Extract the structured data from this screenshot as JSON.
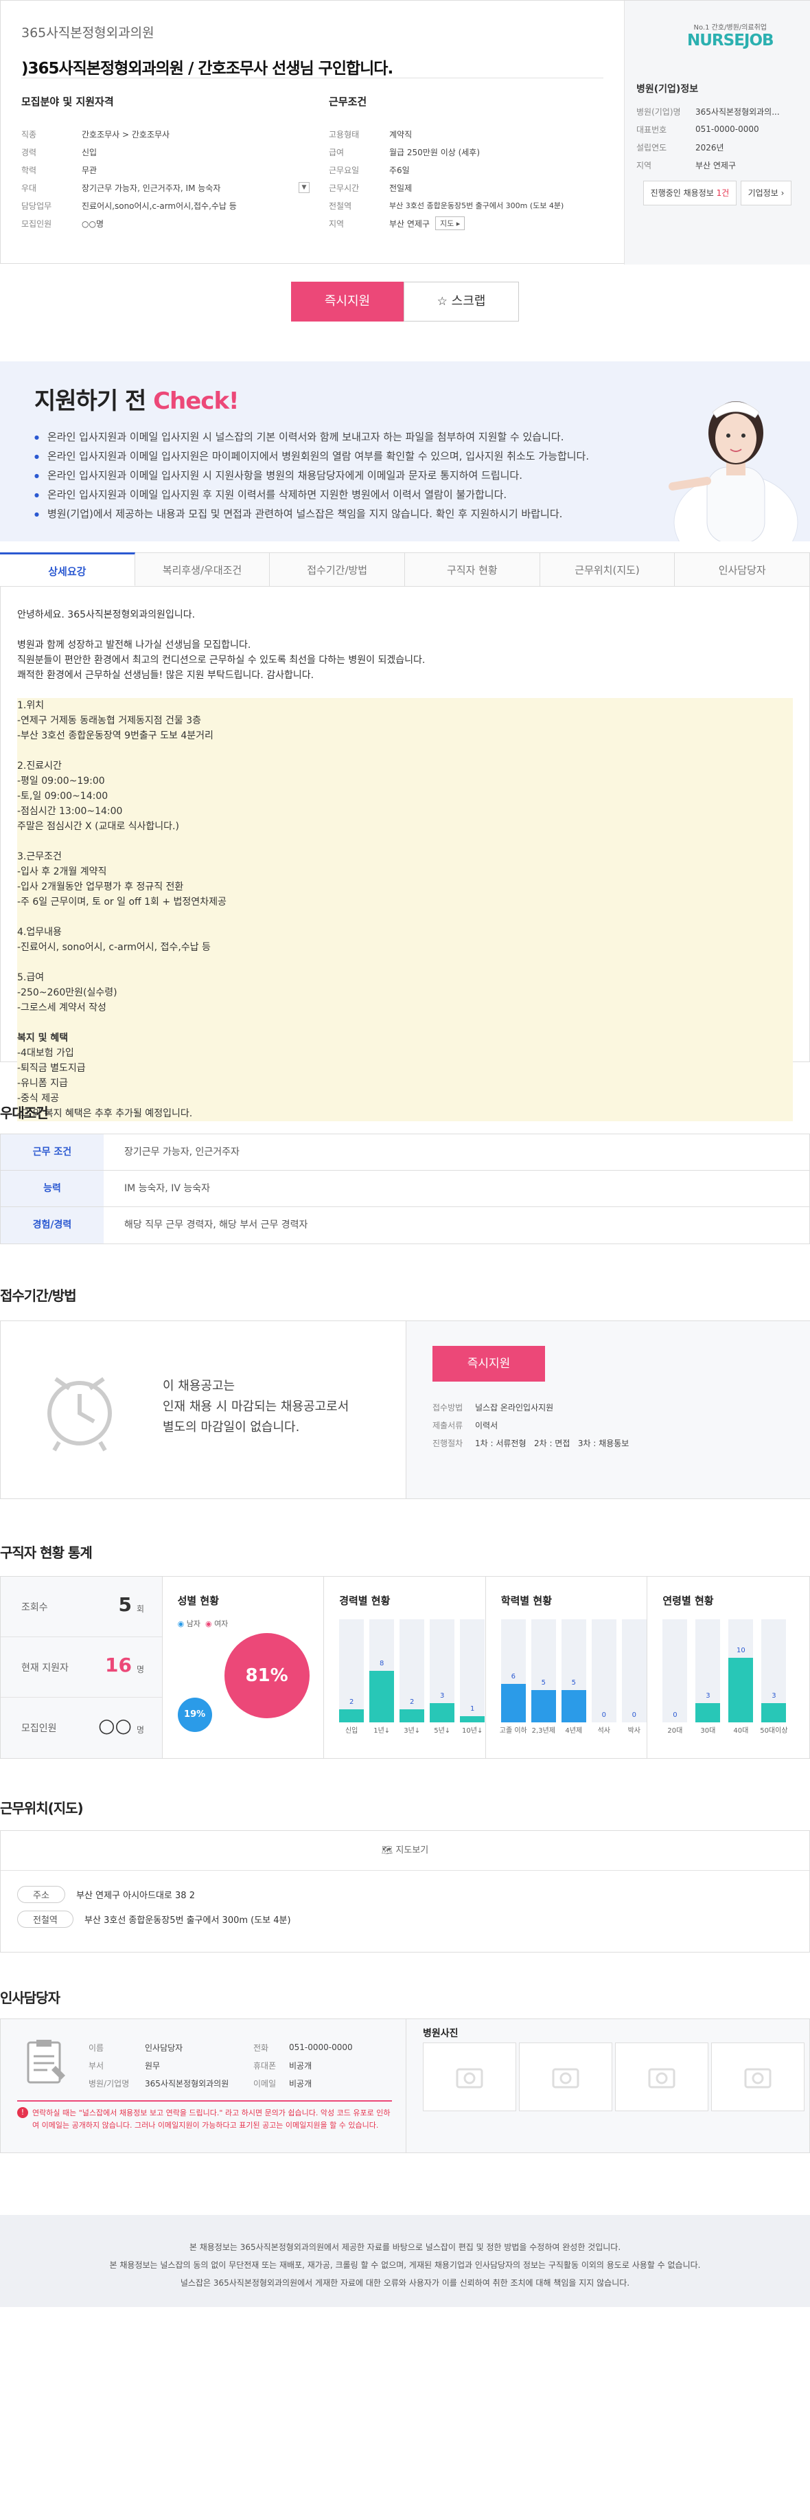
{
  "header": {
    "hospital": "365사직본정형외과의원",
    "title": ")365사직본정형외과의원 / 간호조무사 선생님 구인합니다."
  },
  "recruit": {
    "heading": "모집분야 및 지원자격",
    "rows": [
      {
        "k": "직종",
        "v": "간호조무사 > 간호조무사"
      },
      {
        "k": "경력",
        "v": "신입"
      },
      {
        "k": "학력",
        "v": "무관"
      },
      {
        "k": "우대",
        "v": "장기근무 가능자, 인근거주자, IM 능숙자"
      },
      {
        "k": "담당업무",
        "v": "진료어시,sono어시,c-arm어시,접수,수납 등"
      },
      {
        "k": "모집인원",
        "v": "○○명"
      }
    ]
  },
  "work": {
    "heading": "근무조건",
    "rows": [
      {
        "k": "고용형태",
        "v": "계약직"
      },
      {
        "k": "급여",
        "v": "월급 250만원 이상 (세후)"
      },
      {
        "k": "근무요일",
        "v": "주6일"
      },
      {
        "k": "근무시간",
        "v": "전일제"
      },
      {
        "k": "전철역",
        "v": "부산 3호선 종합운동장5번 출구에서 300m (도보 4분)",
        "line": "부산 3호선"
      },
      {
        "k": "지역",
        "v": "부산 연제구",
        "btn": "지도"
      }
    ]
  },
  "side": {
    "logo_sub": "No.1 간호/병원/의료취업",
    "logo_name": "NURSEJOB",
    "heading": "병원(기업)정보",
    "rows": [
      {
        "k": "병원(기업)명",
        "v": "365사직본정형외과의..."
      },
      {
        "k": "대표번호",
        "v": "051-0000-0000"
      },
      {
        "k": "설립연도",
        "v": "2026년"
      },
      {
        "k": "지역",
        "v": "부산 연제구"
      }
    ],
    "btn_ongoing": "진행중인 채용정보",
    "ongoing_count": "1건",
    "btn_info": "기업정보"
  },
  "actions": {
    "apply": "즉시지원",
    "scrap": "스크랩"
  },
  "banner": {
    "title_a": "지원하기 전 ",
    "title_b": "Check!",
    "items": [
      "온라인 입사지원과 이메일 입사지원 시 널스잡의 기본 이력서와 함께 보내고자 하는 파일을 첨부하여 지원할 수 있습니다.",
      "온라인 입사지원과 이메일 입사지원은 마이페이지에서 병원회원의 열람 여부를 확인할 수 있으며, 입사지원 취소도 가능합니다.",
      "온라인 입사지원과 이메일 입사지원 시 지원사항을 병원의 채용담당자에게 이메일과 문자로 통지하여 드립니다.",
      "온라인 입사지원과 이메일 입사지원 후 지원 이력서를 삭제하면 지원한 병원에서 이력서 열람이 불가합니다.",
      "병원(기업)에서 제공하는 내용과 모집 및 면접과 관련하여 널스잡은 책임을 지지 않습니다. 확인 후 지원하시기 바랍니다."
    ]
  },
  "tabs": [
    "상세요강",
    "복리후생/우대조건",
    "접수기간/방법",
    "구직자 현황",
    "근무위치(지도)",
    "인사담당자"
  ],
  "detail": {
    "lines": [
      "안녕하세요. 365사직본정형외과의원입니다.",
      "",
      "병원과 함께 성장하고 발전해 나가실 선생님을 모집합니다.",
      "직원분들이 편안한 환경에서 최고의 컨디션으로 근무하실 수 있도록 최선을 다하는 병원이 되겠습니다.",
      "쾌적한 환경에서 근무하실 선생님들! 많은 지원 부탁드립니다. 감사합니다.",
      "",
      "1.위치",
      "-연제구 거제동 동래농협 거제동지점 건물 3층",
      "-부산 3호선 종합운동장역 9번출구 도보 4분거리",
      "",
      "2.진료시간",
      "-평일 09:00~19:00",
      "-토,일 09:00~14:00",
      "-점심시간 13:00~14:00",
      "주말은 점심시간 X (교대로 식사합니다.)",
      "",
      "3.근무조건",
      "-입사 후 2개월 계약직",
      "-입사 2개월동안 업무평가 후 정규직 전환",
      "-주 6일 근무이며, 토 or 일 off 1회 + 법정연차제공",
      "",
      "4.업무내용",
      "-진료어시, sono어시, c-arm어시, 접수,수납 등",
      "",
      "5.급여",
      "-250~260만원(실수령)",
      "-그로스세 계약서 작성",
      "",
      "복지 및 혜택",
      "-4대보험 가입",
      "-퇴직금 별도지급",
      "-유니폼 지급",
      "-중식 제공",
      "-그 외 복지 혜택은 추후 추가될 예정입니다."
    ]
  },
  "pref": {
    "title": "우대조건",
    "rows": [
      {
        "k": "근무 조건",
        "v": "장기근무 가능자, 인근거주자"
      },
      {
        "k": "능력",
        "v": "IM 능숙자, IV 능숙자"
      },
      {
        "k": "경험/경력",
        "v": "해당 직무 근무 경력자, 해당 부서 근무 경력자"
      }
    ]
  },
  "period": {
    "title": "접수기간/방법",
    "closed_lines": [
      "이 채용공고는",
      "인재 채용 시 마감되는 채용공고로서",
      "별도의 마감일이 없습니다."
    ],
    "apply": "즉시지원",
    "rows": [
      {
        "k": "접수방법",
        "v": "널스잡 온라인입사지원"
      },
      {
        "k": "제출서류",
        "v": "이력서"
      },
      {
        "k": "진행절차",
        "v": "1차 : 서류전형   2차 : 면접   3차 : 채용통보"
      }
    ]
  },
  "stats": {
    "title": "구직자 현황 통계",
    "summary": [
      {
        "k": "조회수",
        "v": "5",
        "u": "회",
        "c": "#333"
      },
      {
        "k": "현재 지원자",
        "v": "16",
        "u": "명",
        "c": "#ec4878"
      },
      {
        "k": "모집인원",
        "v": "○○",
        "u": "명",
        "c": "#333"
      }
    ],
    "gender": {
      "title": "성별 현황",
      "male": "남자",
      "female": "여자",
      "male_pct": "19%",
      "female_pct": "81%"
    },
    "career": {
      "title": "경력별 현황",
      "labels": [
        "신입",
        "1년↓",
        "3년↓",
        "5년↓",
        "10년↓"
      ],
      "values": [
        2,
        8,
        2,
        3,
        1
      ],
      "max": 16
    },
    "edu": {
      "title": "학력별 현황",
      "labels": [
        "고졸 이하",
        "2,3년제",
        "4년제",
        "석사",
        "박사"
      ],
      "values": [
        6,
        5,
        5,
        0,
        0
      ],
      "max": 16
    },
    "age": {
      "title": "연령별 현황",
      "labels": [
        "20대",
        "30대",
        "40대",
        "50대이상"
      ],
      "values": [
        0,
        3,
        10,
        3
      ],
      "max": 16
    }
  },
  "location": {
    "title": "근무위치(지도)",
    "map_btn": "지도보기",
    "rows": [
      {
        "k": "주소",
        "v": "부산 연제구 아시아드대로 38 2"
      },
      {
        "k": "전철역",
        "v": "부산 3호선 종합운동장5번 출구에서 300m (도보 4분)"
      }
    ]
  },
  "manager": {
    "title": "인사담당자",
    "left": [
      {
        "k": "이름",
        "v": "인사담당자"
      },
      {
        "k": "부서",
        "v": "원무"
      },
      {
        "k": "병원/기업명",
        "v": "365사직본정형외과의원"
      }
    ],
    "right": [
      {
        "k": "전화",
        "v": "051-0000-0000"
      },
      {
        "k": "휴대폰",
        "v": "비공개"
      },
      {
        "k": "이메일",
        "v": "비공개"
      }
    ],
    "notice": "연락하실 때는 \"널스잡에서 채용정보 보고 연락을 드립니다.\" 라고 하시면 문의가 쉽습니다. 악성 코드 유포로 인하여 이메일는 공개하지 않습니다. 그러나 이메일지원이 가능하다고 표기된 공고는 이메일지원을 할 수 있습니다.",
    "photo_title": "병원사진"
  },
  "footer": {
    "lines": [
      "본 채용정보는 365사직본정형외과의원에서 제공한 자료를 바탕으로 널스잡이 편집 및 정한 방법을 수정하여 완성한 것입니다.",
      "본 채용정보는 널스잡의 동의 없이 무단전재 또는 재배포, 재가공, 크롤링 할 수 없으며, 게재된 채용기업과 인사담당자의 정보는 구직활동 이외의 용도로 사용할 수 없습니다.",
      "널스잡은 365사직본정형외과의원에서 게재한 자료에 대한 오류와 사용자가 이를 신뢰하여 취한 조치에 대해 책임을 지지 않습니다."
    ]
  }
}
